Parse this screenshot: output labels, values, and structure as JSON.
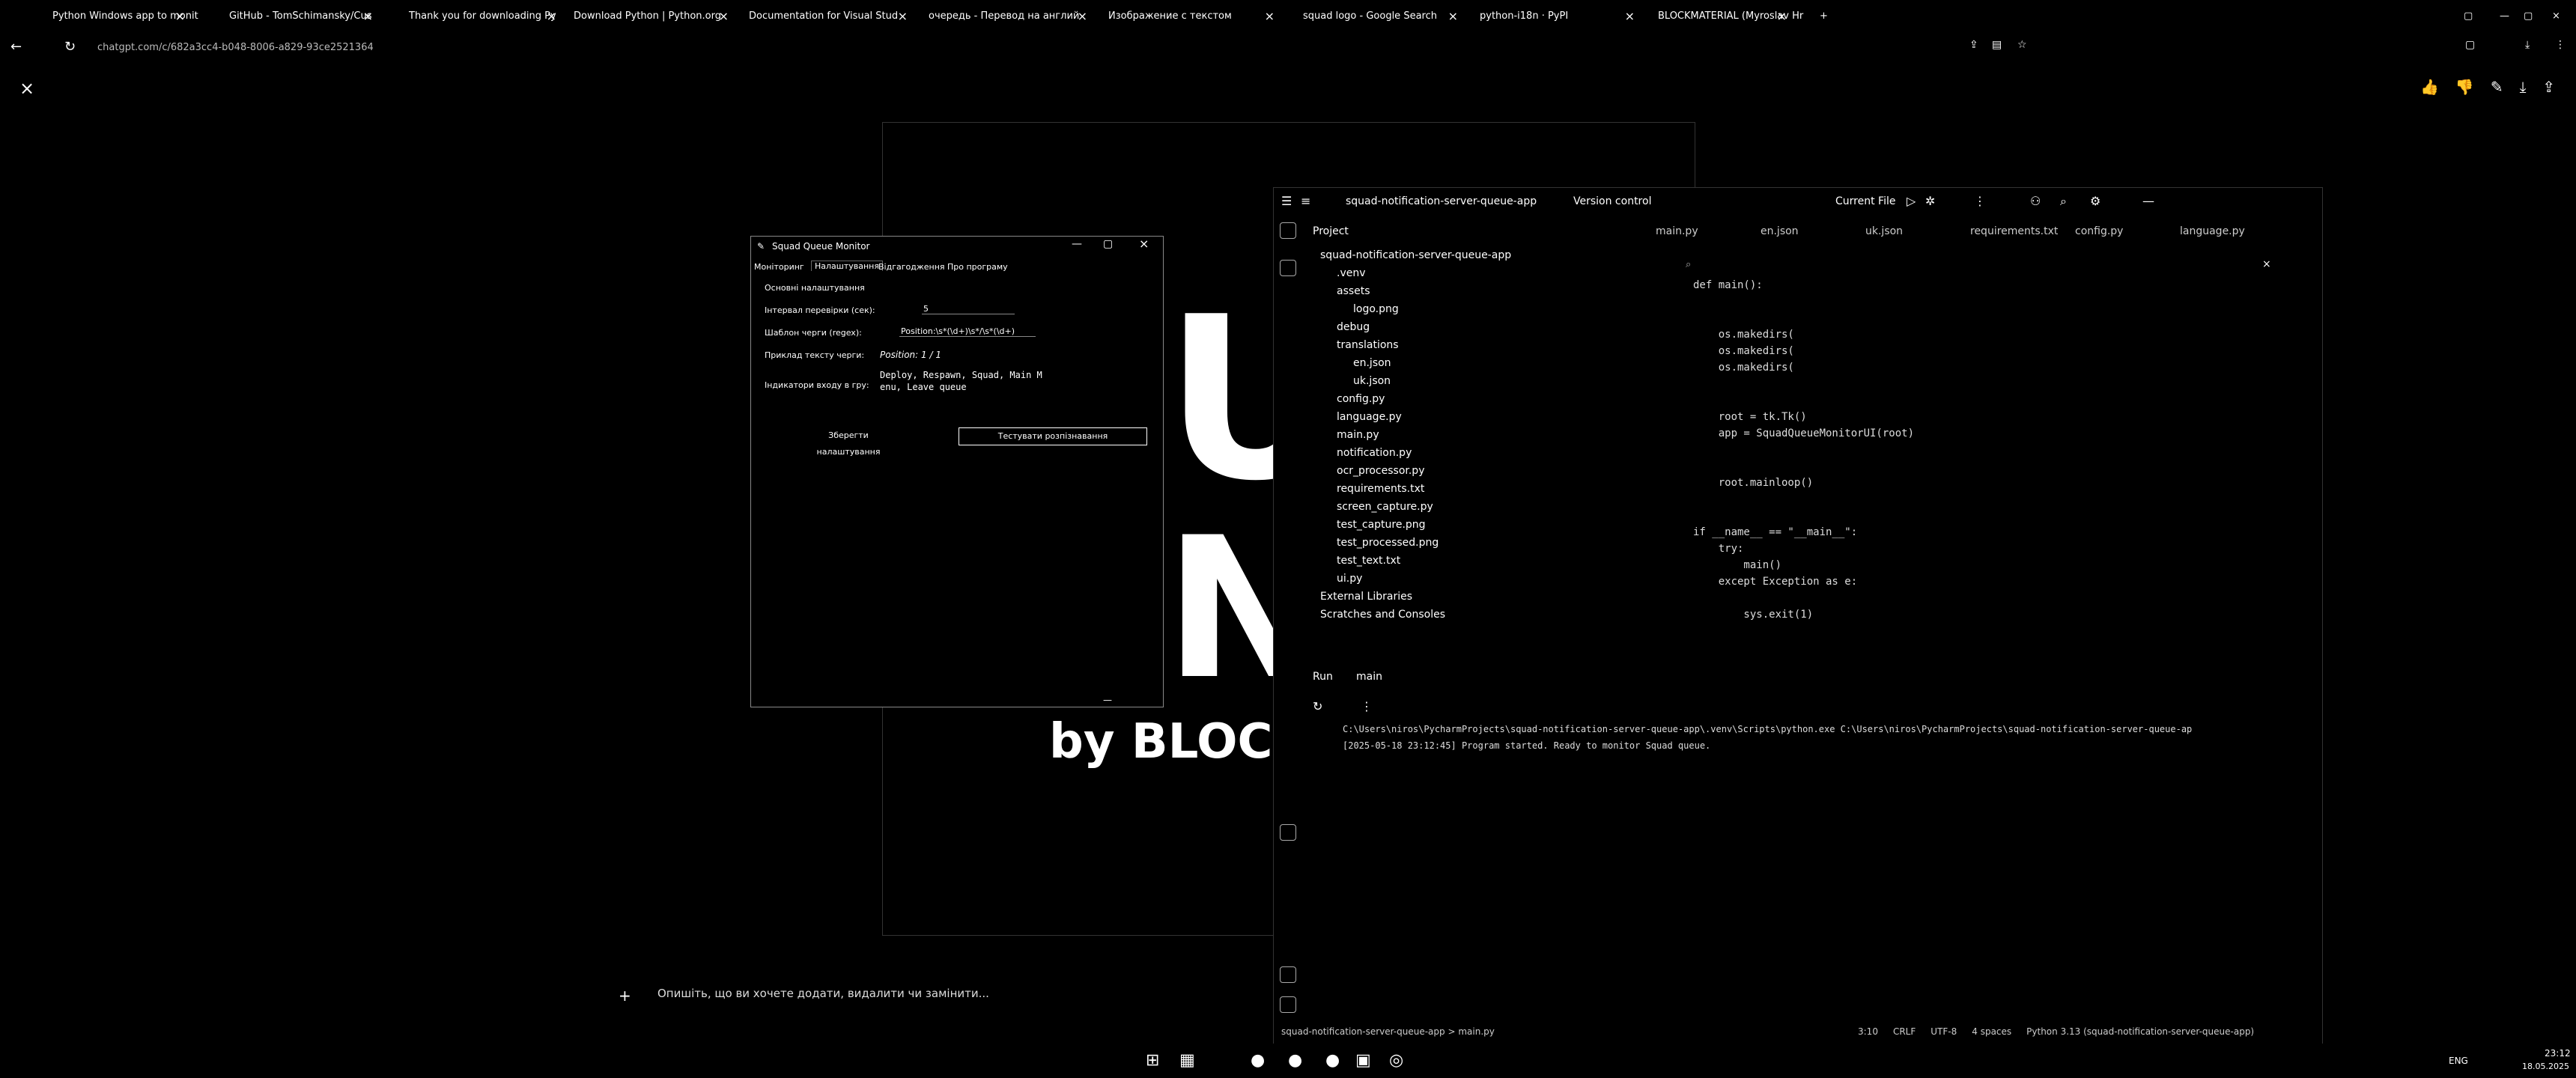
{
  "browser": {
    "tabs": [
      {
        "label": "Python Windows app to monit"
      },
      {
        "label": "GitHub - TomSchimansky/Cus"
      },
      {
        "label": "Thank you for downloading Py"
      },
      {
        "label": "Download Python | Python.org"
      },
      {
        "label": "Documentation for Visual Stud"
      },
      {
        "label": "очередь - Перевод на англий"
      },
      {
        "label": "Изображение с текстом"
      },
      {
        "label": "squad logo - Google Search"
      },
      {
        "label": "python-i18n · PyPI"
      },
      {
        "label": "BLOCKMATERIAL (Myroslav Hr"
      }
    ],
    "url": "chatgpt.com/c/682a3cc4-b048-8006-a829-93ce2521364"
  },
  "viewer": {
    "banner_text": "by BLOCK",
    "big_letters_1": "UA",
    "big_letters_2": "N"
  },
  "sqm": {
    "title": "Squad Queue Monitor",
    "tabs": [
      "Моніторинг",
      "Налаштування",
      "Відгагодження",
      "Про програму"
    ],
    "section": "Основні налаштування",
    "interval_label": "Інтервал перевірки (сек):",
    "interval_value": "5",
    "pattern_label": "Шаблон черги (regex):",
    "pattern_value": "Position:\\s*(\\d+)\\s*/\\s*(\\d+)",
    "example_label": "Приклад тексту черги:",
    "example_value": "Position: 1 / 1",
    "indicators_label": "Індикатори входу в гру:",
    "indicators_value_1": "Deploy, Respawn, Squad, Main M",
    "indicators_value_2": "enu, Leave queue",
    "save_button": "Зберегти налаштування",
    "test_button": "Тестувати розпізнавання"
  },
  "ide": {
    "project_name": "squad-notification-server-queue-app",
    "vcs": "Version control",
    "run_config": "Current File",
    "project_label": "Project",
    "file_tabs": [
      "main.py",
      "en.json",
      "uk.json",
      "requirements.txt",
      "config.py",
      "language.py"
    ],
    "tree": [
      {
        "label": "squad-notification-server-queue-app",
        "indent": 0
      },
      {
        "label": ".venv",
        "indent": 1
      },
      {
        "label": "assets",
        "indent": 1
      },
      {
        "label": "logo.png",
        "indent": 2
      },
      {
        "label": "debug",
        "indent": 1
      },
      {
        "label": "translations",
        "indent": 1
      },
      {
        "label": "en.json",
        "indent": 2
      },
      {
        "label": "uk.json",
        "indent": 2
      },
      {
        "label": "config.py",
        "indent": 1
      },
      {
        "label": "language.py",
        "indent": 1
      },
      {
        "label": "main.py",
        "indent": 1
      },
      {
        "label": "notification.py",
        "indent": 1
      },
      {
        "label": "ocr_processor.py",
        "indent": 1
      },
      {
        "label": "requirements.txt",
        "indent": 1
      },
      {
        "label": "screen_capture.py",
        "indent": 1
      },
      {
        "label": "test_capture.png",
        "indent": 1
      },
      {
        "label": "test_processed.png",
        "indent": 1
      },
      {
        "label": "test_text.txt",
        "indent": 1
      },
      {
        "label": "ui.py",
        "indent": 1
      },
      {
        "label": "External Libraries",
        "indent": 0
      },
      {
        "label": "Scratches and Consoles",
        "indent": 0
      }
    ],
    "code": [
      "def main():",
      "",
      "",
      "    os.makedirs(",
      "    os.makedirs(",
      "    os.makedirs(",
      "",
      "",
      "    root = tk.Tk()",
      "    app = SquadQueueMonitorUI(root)",
      "",
      "",
      "    root.mainloop()",
      "",
      "",
      "if __name__ == \"__main__\":",
      "    try:",
      "        main()",
      "    except Exception as e:",
      "",
      "        sys.exit(1)"
    ],
    "run_tab": "Run",
    "run_name": "main",
    "console_1": "C:\\Users\\niros\\PycharmProjects\\squad-notification-server-queue-app\\.venv\\Scripts\\python.exe C:\\Users\\niros\\PycharmProjects\\squad-notification-server-queue-ap",
    "console_2": "[2025-05-18 23:12:45] Program started. Ready to monitor Squad queue.",
    "status_path": "squad-notification-server-queue-app > main.py",
    "status_pos": "3:10",
    "status_crlf": "CRLF",
    "status_enc": "UTF-8",
    "status_indent": "4 spaces",
    "status_interp": "Python 3.13 (squad-notification-server-queue-app)"
  },
  "chat": {
    "placeholder": "Опишіть, що ви хочете додати, видалити чи замінити..."
  },
  "taskbar": {
    "lang": "ENG",
    "time": "23:12",
    "date": "18.05.2025"
  }
}
